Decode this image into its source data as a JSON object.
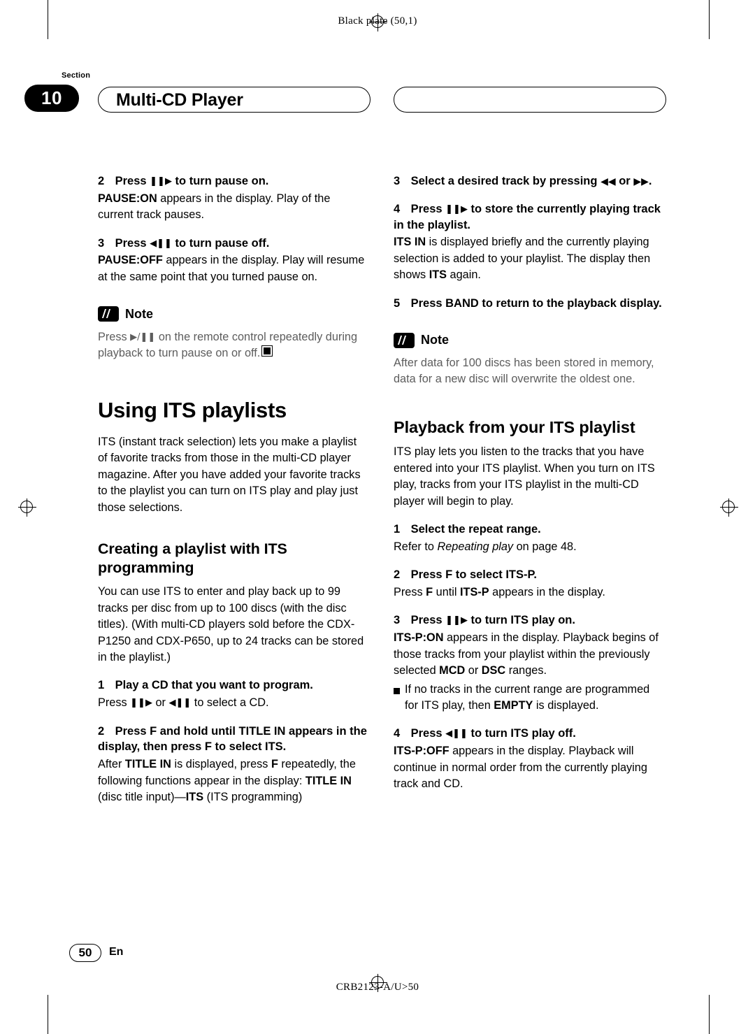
{
  "page": {
    "plate_label": "Black plate (50,1)",
    "footer_code": "CRB2123-A/U>50",
    "page_number": "50",
    "page_lang": "En"
  },
  "header": {
    "section_word": "Section",
    "section_number": "10",
    "chapter_title": "Multi-CD Player"
  },
  "left_column": {
    "step2": {
      "num": "2",
      "text_before": "Press",
      "glyph": "❚❚▶",
      "text_after": "to turn pause on."
    },
    "step2_body_bold": "PAUSE:ON",
    "step2_body": " appears in the display. Play of the current track pauses.",
    "step3": {
      "num": "3",
      "text_before": "Press",
      "glyph": "◀❚❚",
      "text_after": "to turn pause off."
    },
    "step3_body_bold": "PAUSE:OFF",
    "step3_body": " appears in the display. Play will resume at the same point that you turned pause on.",
    "note_label": "Note",
    "note_text_a": "Press ",
    "note_glyph": "▶/❚❚",
    "note_text_b": " on the remote control repeatedly during playback to turn pause on or off.",
    "heading_its": "Using ITS playlists",
    "its_intro": "ITS (instant track selection) lets you make a playlist of favorite tracks from those in the multi-CD player magazine. After you have added your favorite tracks to the playlist you can turn on ITS play and play just those selections.",
    "heading_creating": "Creating a playlist with ITS programming",
    "creating_body": "You can use ITS to enter and play back up to 99 tracks per disc from up to 100 discs (with the disc titles). (With multi-CD players sold before the CDX-P1250 and CDX-P650, up to 24 tracks can be stored in the playlist.)",
    "step_play": {
      "num": "1",
      "text": "Play a CD that you want to program."
    },
    "step_play_body_a": "Press ",
    "step_play_glyph1": "❚❚▶",
    "step_play_body_b": " or ",
    "step_play_glyph2": "◀❚❚",
    "step_play_body_c": " to select a CD.",
    "step_title_in": {
      "num": "2",
      "text": "Press F and hold until TITLE IN appears in the display, then press F to select ITS."
    },
    "title_in_body_1": "After ",
    "title_in_bold_1": "TITLE IN",
    "title_in_body_2": " is displayed, press ",
    "title_in_bold_2": "F",
    "title_in_body_3": " repeatedly, the following functions appear in the display:",
    "title_in_bold_3": "TITLE IN",
    "title_in_body_4": " (disc title input)—",
    "title_in_bold_4": "ITS",
    "title_in_body_5": " (ITS programming)"
  },
  "right_column": {
    "step3": {
      "num": "3",
      "text_before": "Select a desired track by pressing",
      "glyph1": "◀◀",
      "text_mid": "or",
      "glyph2": "▶▶",
      "text_after": "."
    },
    "step4": {
      "num": "4",
      "text_before": "Press",
      "glyph": "❚❚▶",
      "text_after": "to store the currently playing track in the playlist."
    },
    "step4_bold": "ITS IN",
    "step4_body_a": " is displayed briefly and the currently playing selection is added to your playlist. The display then shows ",
    "step4_bold_2": "ITS",
    "step4_body_b": " again.",
    "step5": {
      "num": "5",
      "text": "Press BAND to return to the playback display."
    },
    "note_label": "Note",
    "note_text": "After data for 100 discs has been stored in memory, data for a new disc will overwrite the oldest one.",
    "heading_playback": "Playback from your ITS playlist",
    "playback_body": "ITS play lets you listen to the tracks that you have entered into your ITS playlist. When you turn on ITS play, tracks from your ITS playlist in the multi-CD player will begin to play.",
    "step_repeat": {
      "num": "1",
      "text": "Select the repeat range."
    },
    "step_repeat_body_a": "Refer to ",
    "step_repeat_italic": "Repeating play",
    "step_repeat_body_b": " on page 48.",
    "step_itsp": {
      "num": "2",
      "text": "Press F to select ITS-P."
    },
    "itsp_body_a": "Press ",
    "itsp_bold_1": "F",
    "itsp_body_b": " until ",
    "itsp_bold_2": "ITS-P",
    "itsp_body_c": " appears in the display.",
    "step_on": {
      "num": "3",
      "text_before": "Press",
      "glyph": "❚❚▶",
      "text_after": "to turn ITS play on."
    },
    "on_bold": "ITS-P:ON",
    "on_body_a": " appears in the display. Playback begins of those tracks from your playlist within the previously selected ",
    "on_bold_2": "MCD",
    "on_body_b": " or ",
    "on_bold_3": "DSC",
    "on_body_c": " ranges.",
    "bullet_a": "If no tracks in the current range are programmed for ITS play, then ",
    "bullet_bold": "EMPTY",
    "bullet_b": " is displayed.",
    "step_off": {
      "num": "4",
      "text_before": "Press",
      "glyph": "◀❚❚",
      "text_after": "to turn ITS play off."
    },
    "off_bold": "ITS-P:OFF",
    "off_body": " appears in the display. Playback will continue in normal order from the currently playing track and CD."
  }
}
